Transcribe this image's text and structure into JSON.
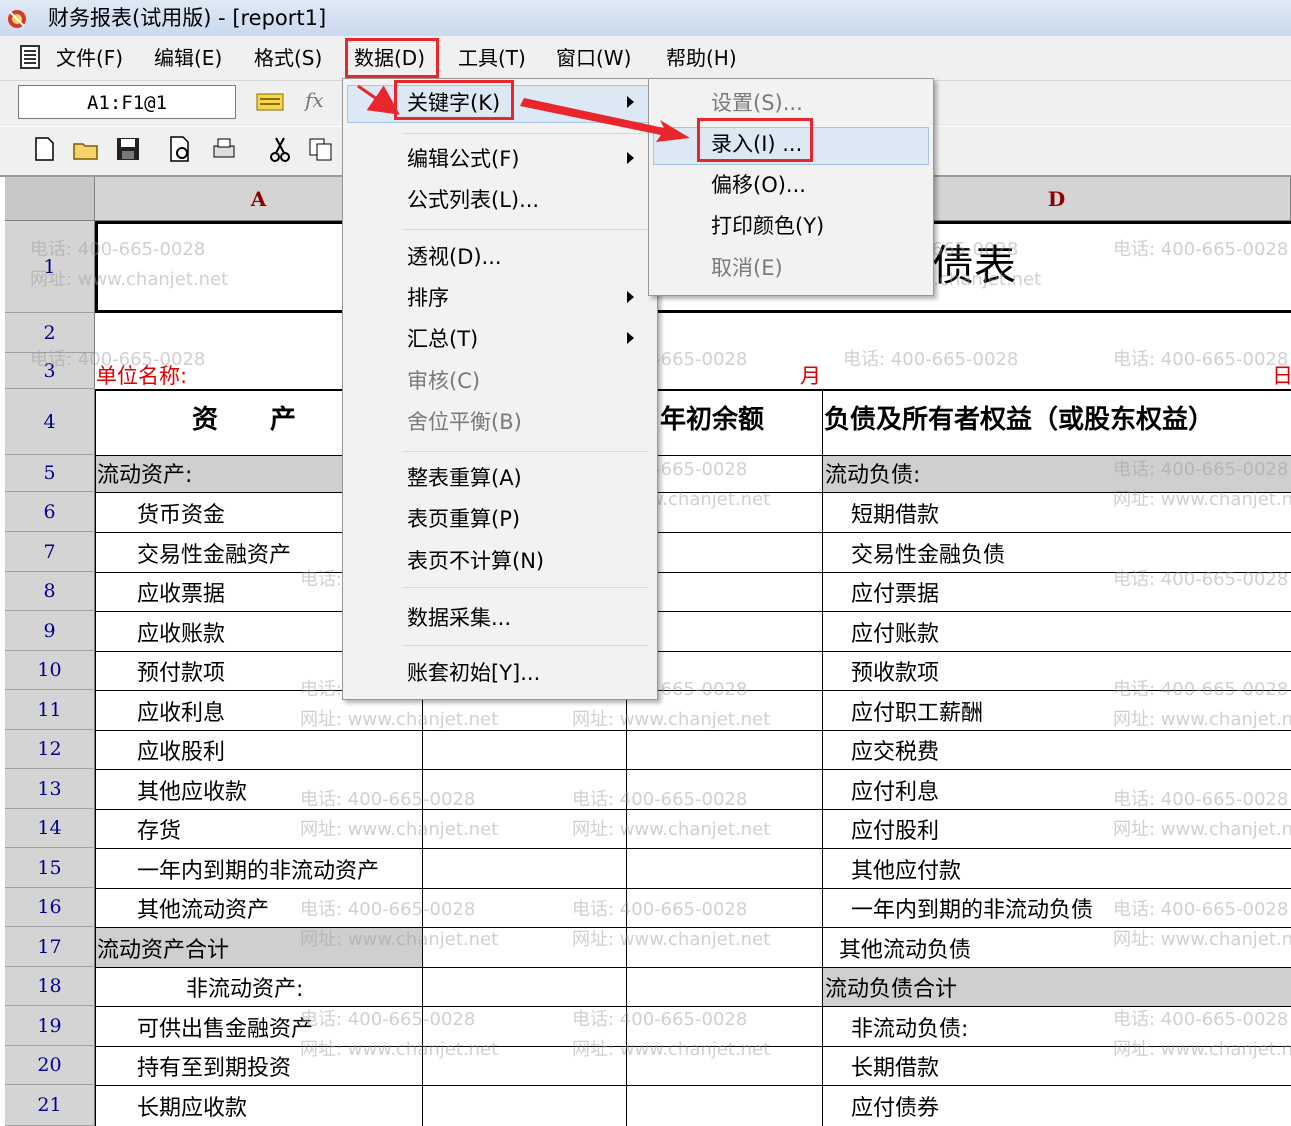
{
  "window": {
    "title": "财务报表(试用版) - [report1]"
  },
  "menubar": {
    "items": [
      "文件(F)",
      "编辑(E)",
      "格式(S)",
      "数据(D)",
      "工具(T)",
      "窗口(W)",
      "帮助(H)"
    ]
  },
  "formula_bar": {
    "cell_ref": "A1:F1@1",
    "fx": "fx"
  },
  "sheet": {
    "columns": [
      "A",
      "D"
    ],
    "rows": [
      "1",
      "2",
      "3",
      "4",
      "5",
      "6",
      "7",
      "8",
      "9",
      "10",
      "11",
      "12",
      "13",
      "14",
      "15",
      "16",
      "17",
      "18",
      "19",
      "20",
      "21"
    ],
    "title_partial": "债表",
    "unit_label": "单位名称:",
    "month_label": "月",
    "day_label": "日",
    "header_assets": "资　　产",
    "header_opening": "年初余额",
    "header_liabilities": "负债及所有者权益（或股东权益）",
    "assets": [
      "流动资产:",
      "货币资金",
      "交易性金融资产",
      "应收票据",
      "应收账款",
      "预付款项",
      "应收利息",
      "应收股利",
      "其他应收款",
      "存货",
      "一年内到期的非流动资产",
      "其他流动资产",
      "流动资产合计",
      "非流动资产:",
      "可供出售金融资产",
      "持有至到期投资",
      "长期应收款"
    ],
    "liabilities": [
      "流动负债:",
      "短期借款",
      "交易性金融负债",
      "应付票据",
      "应付账款",
      "预收款项",
      "应付职工薪酬",
      "应交税费",
      "应付利息",
      "应付股利",
      "其他应付款",
      "一年内到期的非流动负债",
      "其他流动负债",
      "流动负债合计",
      "非流动负债:",
      "长期借款",
      "应付债券"
    ]
  },
  "watermark": {
    "phone": "电话: 400-665-0028",
    "site": "网址: www.chanjet.net"
  },
  "data_menu": {
    "items": [
      "关键字(K)",
      "编辑公式(F)",
      "公式列表(L)...",
      "透视(D)...",
      "排序",
      "汇总(T)",
      "审核(C)",
      "舍位平衡(B)",
      "整表重算(A)",
      "表页重算(P)",
      "表页不计算(N)",
      "数据采集...",
      "账套初始[Y]..."
    ]
  },
  "keyword_submenu": {
    "items": [
      "设置(S)...",
      "录入(I) ...",
      "偏移(O)...",
      "打印颜色(Y)",
      "取消(E)"
    ]
  },
  "colors": {
    "highlight": "#e8262c",
    "menu_bg": "#f2f2f2",
    "header_grey": "#d4d4d4"
  }
}
